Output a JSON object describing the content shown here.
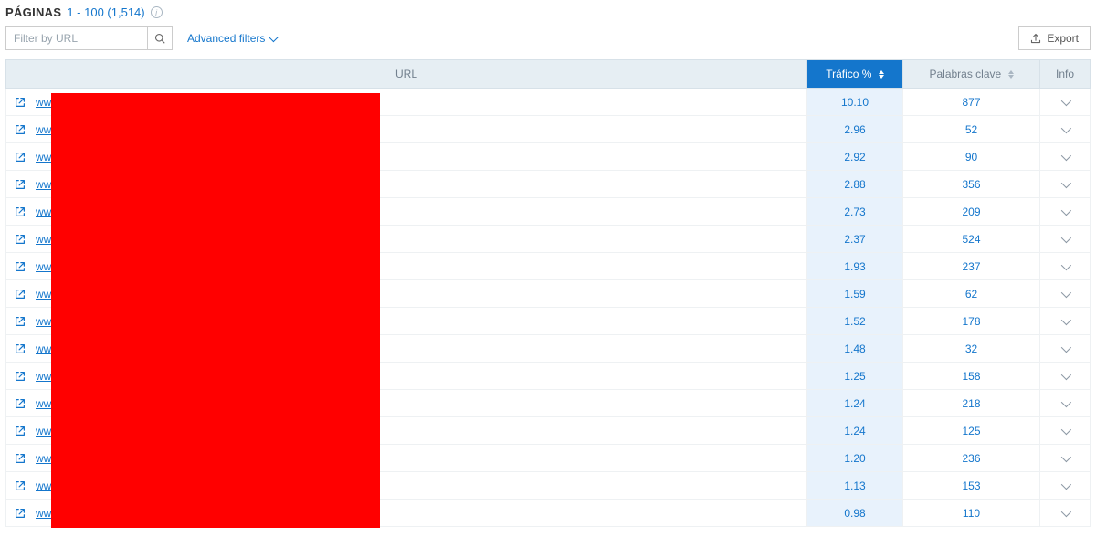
{
  "heading": {
    "label": "PÁGINAS",
    "range": "1 - 100 (1,514)"
  },
  "filter": {
    "placeholder": "Filter by URL"
  },
  "links": {
    "advanced_filters": "Advanced filters",
    "export": "Export"
  },
  "columns": {
    "url": "URL",
    "traffic": "Tráfico %",
    "keywords": "Palabras clave",
    "info": "Info"
  },
  "rows": [
    {
      "url": "www.l",
      "traffic": "10.10",
      "keywords": "877"
    },
    {
      "url": "www.l",
      "traffic": "2.96",
      "keywords": "52"
    },
    {
      "url": "www.l",
      "traffic": "2.92",
      "keywords": "90"
    },
    {
      "url": "www.l",
      "traffic": "2.88",
      "keywords": "356"
    },
    {
      "url": "www.l",
      "traffic": "2.73",
      "keywords": "209"
    },
    {
      "url": "www.l",
      "traffic": "2.37",
      "keywords": "524"
    },
    {
      "url": "www.l",
      "traffic": "1.93",
      "keywords": "237"
    },
    {
      "url": "www.l",
      "traffic": "1.59",
      "keywords": "62"
    },
    {
      "url": "www.l",
      "traffic": "1.52",
      "keywords": "178"
    },
    {
      "url": "www.l",
      "traffic": "1.48",
      "keywords": "32"
    },
    {
      "url": "www.l",
      "traffic": "1.25",
      "keywords": "158"
    },
    {
      "url": "www.l",
      "traffic": "1.24",
      "keywords": "218"
    },
    {
      "url": "www.l",
      "traffic": "1.24",
      "keywords": "125"
    },
    {
      "url": "www.l",
      "traffic": "1.20",
      "keywords": "236"
    },
    {
      "url": "www.l",
      "traffic": "1.13",
      "keywords": "153"
    },
    {
      "url": "www.l",
      "traffic": "0.98",
      "keywords": "110"
    }
  ]
}
